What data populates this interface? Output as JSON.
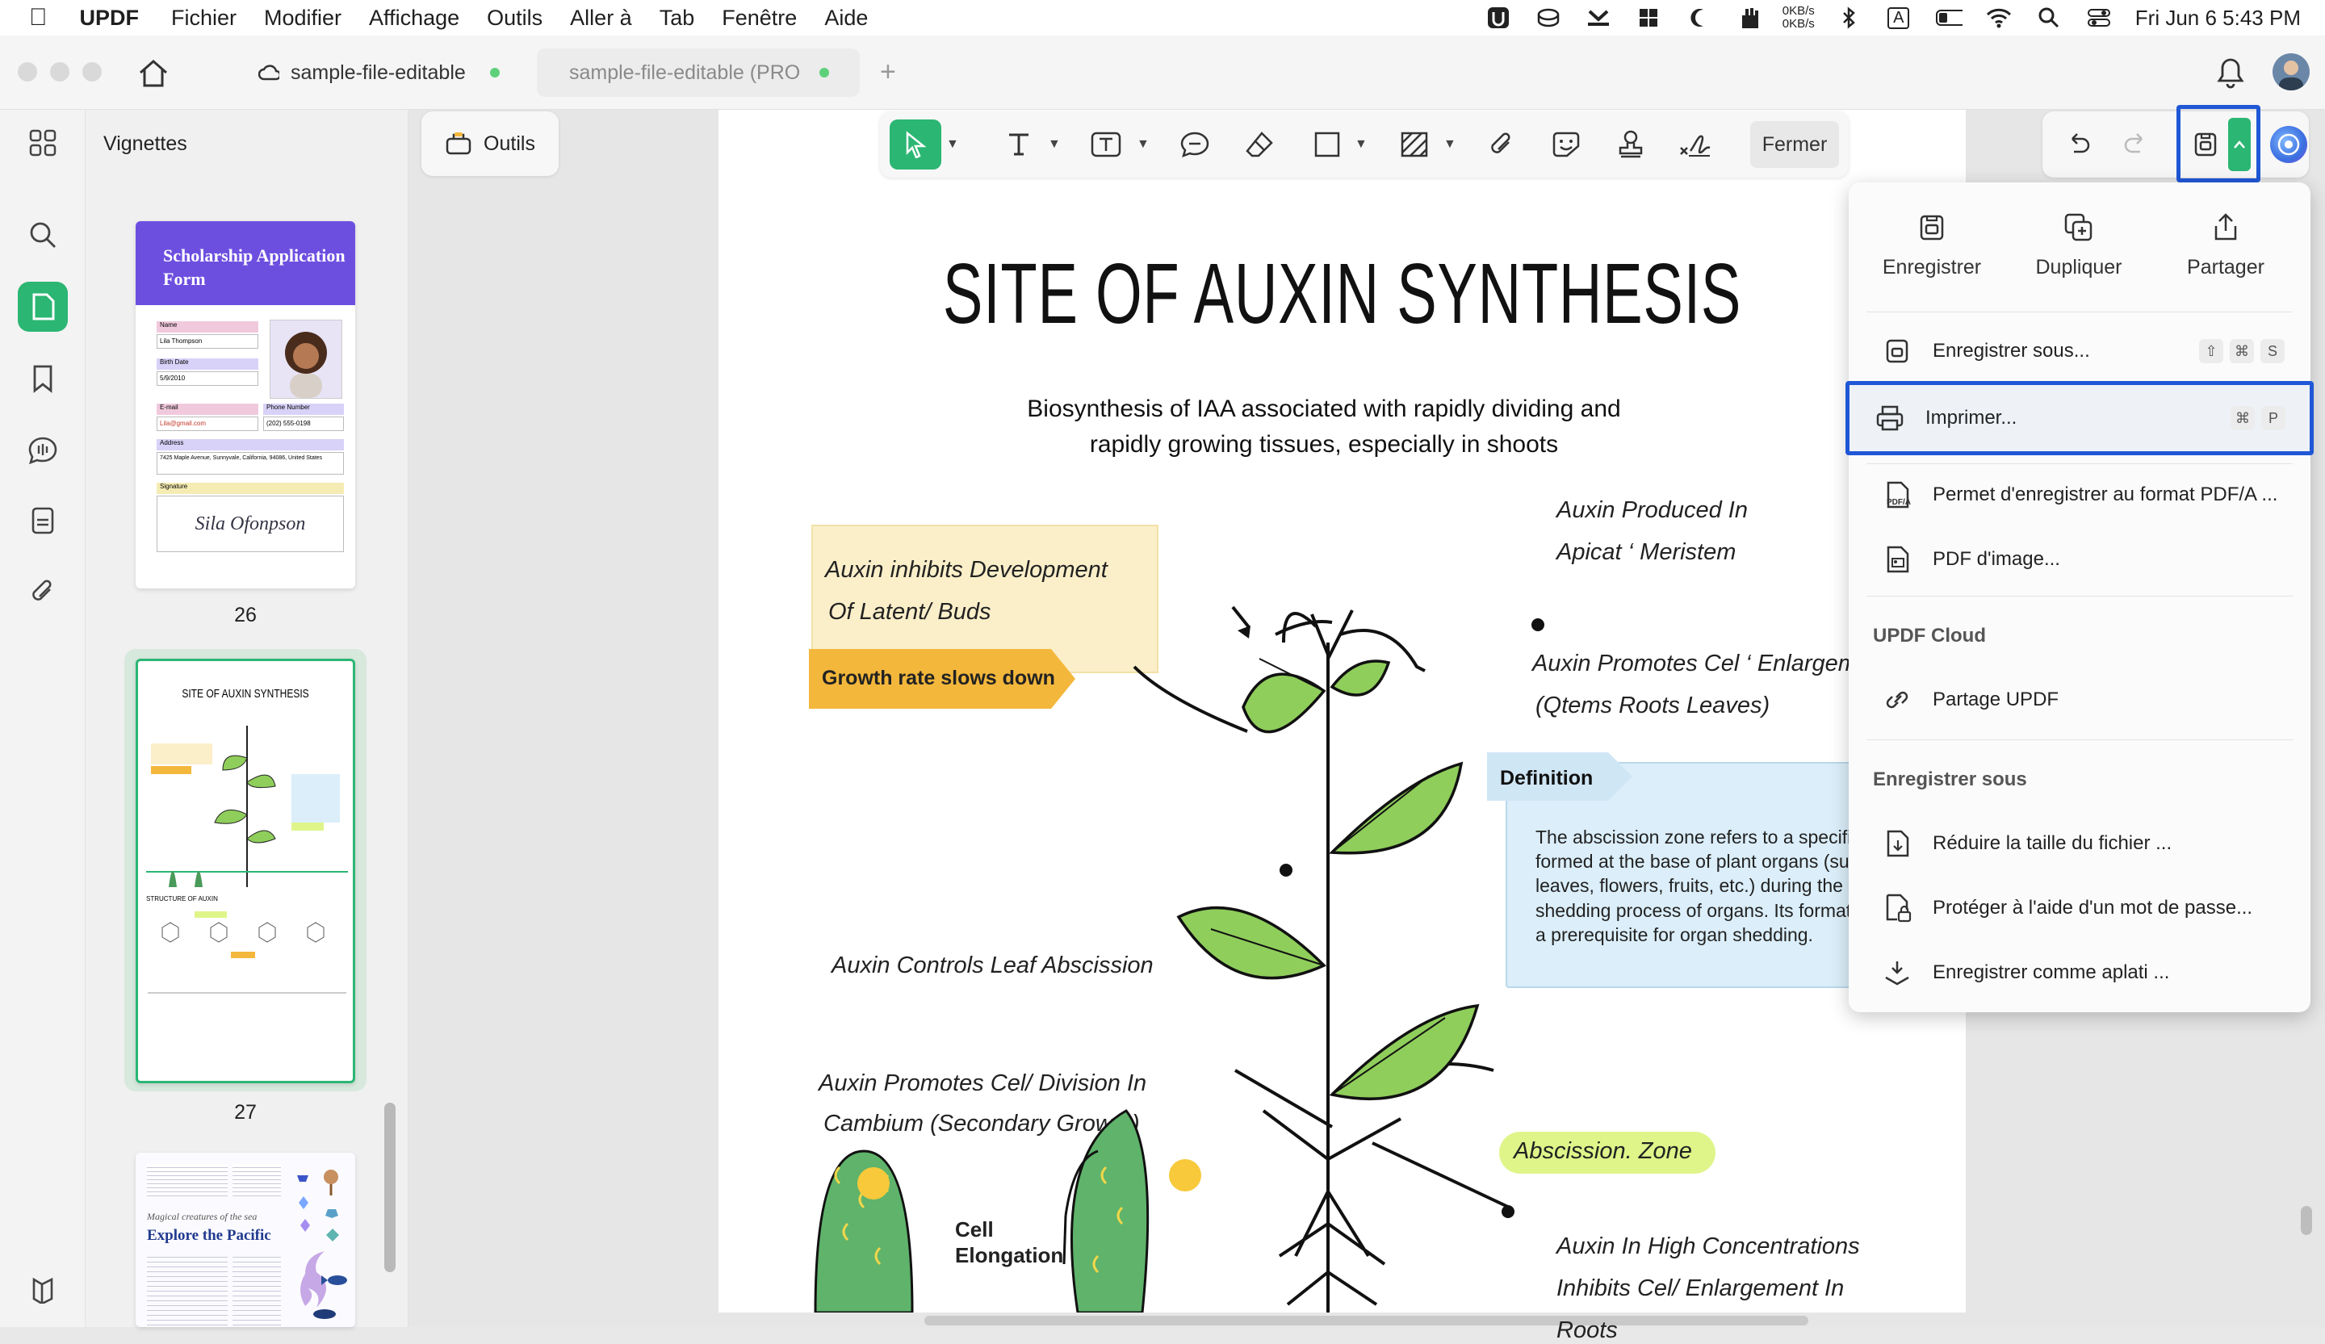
{
  "menubar": {
    "app": "UPDF",
    "items": [
      "Fichier",
      "Modifier",
      "Affichage",
      "Outils",
      "Aller à",
      "Tab",
      "Fenêtre",
      "Aide"
    ],
    "net_up": "0KB/s",
    "net_down": "0KB/s",
    "input_source": "A",
    "datetime": "Fri Jun 6  5:43 PM"
  },
  "tabs": [
    {
      "label": "sample-file-editable"
    },
    {
      "label": "sample-file-editable (PRO"
    }
  ],
  "thumbnails": {
    "title": "Vignettes",
    "pages": [
      {
        "number": "26",
        "heading": "Scholarship Application Form",
        "name_label": "Name",
        "name_value": "Lila Thompson",
        "birth_label": "Birth Date",
        "birth_value": "5/9/2010",
        "email_label": "E-mail",
        "email_value": "Lila@gmail.com",
        "phone_label": "Phone Number",
        "phone_value": "(202) 555-0198",
        "address_label": "Address",
        "address_value": "7425 Maple Avenue, Sunnyvale, California, 94086, United States",
        "signature_label": "Signature",
        "signature": "Sila Ofonpson"
      },
      {
        "number": "27",
        "heading": "SITE OF AUXIN SYNTHESIS",
        "sub": "STRUCTURE OF AUXIN"
      },
      {
        "number": "",
        "heading": "Explore the Pacific",
        "kicker": "Magical creatures of the sea"
      }
    ]
  },
  "toolbar": {
    "outils_label": "Outils",
    "fermer_label": "Fermer"
  },
  "dropdown": {
    "top": [
      {
        "label": "Enregistrer",
        "icon": "save-icon"
      },
      {
        "label": "Dupliquer",
        "icon": "duplicate-icon"
      },
      {
        "label": "Partager",
        "icon": "share-icon"
      }
    ],
    "save_as": {
      "label": "Enregistrer sous...",
      "keys": [
        "⇧",
        "⌘",
        "S"
      ]
    },
    "print": {
      "label": "Imprimer...",
      "keys": [
        "⌘",
        "P"
      ]
    },
    "pdfa": {
      "label": "Permet d'enregistrer au format PDF/A ..."
    },
    "image_pdf": {
      "label": "PDF d'image..."
    },
    "cloud_header": "UPDF Cloud",
    "cloud_share": {
      "label": "Partage UPDF"
    },
    "save_header": "Enregistrer sous",
    "reduce": {
      "label": "Réduire la taille du fichier ..."
    },
    "protect": {
      "label": "Protéger à l'aide d'un mot de passe..."
    },
    "flatten": {
      "label": "Enregistrer comme aplati ..."
    }
  },
  "document": {
    "title": "SITE OF AUXIN SYNTHESIS",
    "subtitle_1": "Biosynthesis of IAA associated with rapidly dividing and",
    "subtitle_2": "rapidly growing tissues, especially in shoots",
    "inhibit_1": "Auxin inhibits Development",
    "inhibit_2": "Of Latent/ Buds",
    "growth_tag": "Growth rate slows down",
    "apical_1": "Auxin Produced In",
    "apical_2": "Apicat ‘ Meristem",
    "promotes_1": "Auxin Promotes Cel ‘ Enlargem",
    "promotes_2": "(Qtems Roots Leaves)",
    "definition_tag": "Definition",
    "definition_1": "The abscission zone refers to a specific",
    "definition_2": "formed at the base of plant organs (suc",
    "definition_3": "leaves, flowers, fruits, etc.) during the",
    "definition_4": "shedding process of organs. Its formatio",
    "definition_5": "a prerequisite for organ shedding.",
    "leaf_abscission": "Auxin Controls Leaf Abscission",
    "division_1": "Auxin Promotes Cel/ Division In",
    "division_2": "Cambium (Secondary Growth)",
    "abscission_zone": "Abscission. Zone",
    "cell_1": "Cell",
    "cell_2": "Elongation",
    "roots_1": "Auxin In High Concentrations",
    "roots_2": "Inhibits Cel/ Enlargement In",
    "roots_3": "Roots"
  },
  "colors": {
    "accent_green": "#2bb673",
    "highlight_blue": "#1f57d6",
    "note_yellow": "#fbefc9",
    "tag_orange": "#f3b73b",
    "def_blue": "#dbeef9",
    "zone_green": "#dff58a"
  }
}
